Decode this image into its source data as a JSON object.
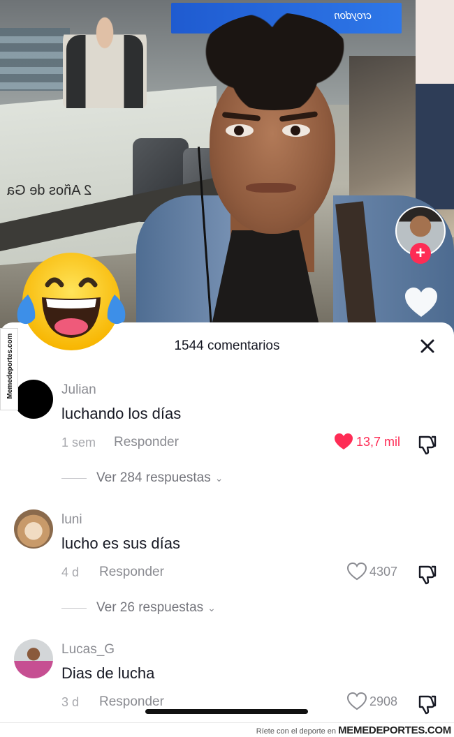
{
  "video": {
    "store_sign": "croydon",
    "ad_text": "2 Años de Ga"
  },
  "side_watermark": "Memedeportes.com",
  "comments_sheet": {
    "title": "1544 comentarios",
    "close_icon": "close-icon",
    "comments": [
      {
        "username": "Julian",
        "text": "luchando los días",
        "time": "1 sem",
        "reply_label": "Responder",
        "likes": "13,7 mil",
        "liked": true,
        "liked_color": "#fe2c55",
        "replies_label": "Ver 284 respuestas"
      },
      {
        "username": "luni",
        "text": "lucho es sus días",
        "time": "4 d",
        "reply_label": "Responder",
        "likes": "4307",
        "liked": false,
        "replies_label": "Ver 26 respuestas"
      },
      {
        "username": "Lucas_G",
        "text": "Dias de lucha",
        "time": "3 d",
        "reply_label": "Responder",
        "likes": "2908",
        "liked": false
      }
    ]
  },
  "footer": {
    "tagline": "Ríete con el deporte en",
    "brand": "MEMEDEPORTES.COM"
  },
  "colors": {
    "accent": "#fe2c55",
    "text_primary": "#161823",
    "text_secondary": "#8a8b91"
  }
}
